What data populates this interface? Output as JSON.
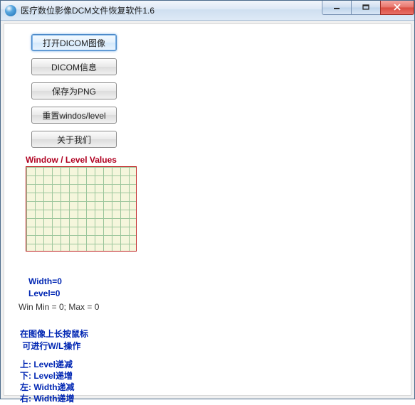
{
  "window": {
    "title": "医疗数位影像DCM文件恢复软件1.6"
  },
  "buttons": {
    "open": "打开DICOM图像",
    "info": "DICOM信息",
    "save_png": "保存为PNG",
    "reset_wl": "重置windos/level",
    "about": "关于我们"
  },
  "wl": {
    "heading": "Window / Level Values",
    "width_label": "Width=",
    "width_value": "0",
    "level_label": "Level=",
    "level_value": "0",
    "minmax": "Win Min = 0; Max = 0"
  },
  "instructions": {
    "line1": "在图像上长按鼠标",
    "line2": " 可进行W/L操作",
    "up": "上: Level递减",
    "down": "下: Level递增",
    "left": "左: Width递减",
    "right": "右: Width递增"
  }
}
